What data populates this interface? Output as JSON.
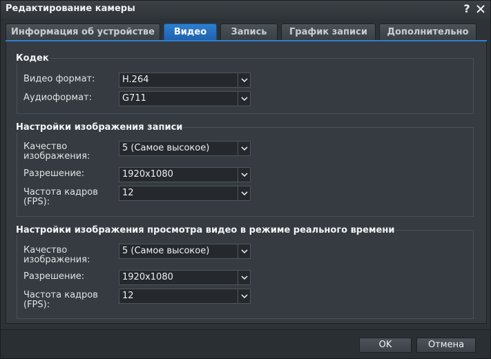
{
  "window": {
    "title": "Редактирование камеры",
    "help_label": "?",
    "close_icon": "close-icon"
  },
  "tabs": [
    {
      "label": "Информация об устройстве",
      "active": false
    },
    {
      "label": "Видео",
      "active": true
    },
    {
      "label": "Запись",
      "active": false
    },
    {
      "label": "График записи",
      "active": false
    },
    {
      "label": "Дополнительно",
      "active": false
    }
  ],
  "codec": {
    "title": "Кодек",
    "video_format_label": "Видео формат:",
    "video_format_value": "H.264",
    "audio_format_label": "Аудиоформат:",
    "audio_format_value": "G711"
  },
  "recording": {
    "title": "Настройки изображения записи",
    "quality_label": "Качество изображения:",
    "quality_value": "5 (Самое высокое)",
    "resolution_label": "Разрешение:",
    "resolution_value": "1920x1080",
    "fps_label": "Частота кадров (FPS):",
    "fps_value": "12"
  },
  "live_view": {
    "title": "Настройки изображения просмотра видео в режиме реального времени",
    "quality_label": "Качество изображения:",
    "quality_value": "5 (Самое высокое)",
    "resolution_label": "Разрешение:",
    "resolution_value": "1920x1080",
    "fps_label": "Частота кадров (FPS):",
    "fps_value": "12"
  },
  "footer": {
    "ok_label": "OK",
    "cancel_label": "Отмена"
  },
  "colors": {
    "accent": "#2e7fd0",
    "background": "#2d3236"
  }
}
